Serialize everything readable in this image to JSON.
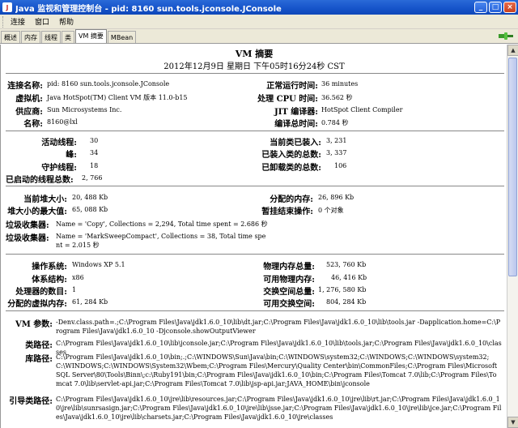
{
  "window": {
    "title": "Java 监视和管理控制台 - pid: 8160 sun.tools.jconsole.JConsole",
    "java_icon": "java-icon",
    "minimize": "_",
    "maximize": "□",
    "close": "×"
  },
  "menu": [
    "连接",
    "窗口",
    "帮助"
  ],
  "tabs": [
    "概述",
    "内存",
    "线程",
    "类",
    "VM 摘要",
    "MBean"
  ],
  "active_tab": "VM 摘要",
  "summary": {
    "title": "VM 摘要",
    "datetime": "2012年12月9日 星期日 下午05时16分24秒 CST"
  },
  "sec1": {
    "connection_name": {
      "label": "连接名称:",
      "value": "pid: 8160 sun.tools.jconsole.JConsole"
    },
    "vm": {
      "label": "虚拟机:",
      "value": "Java HotSpot(TM) Client VM 版本 11.0-b15"
    },
    "vendor": {
      "label": "供应商:",
      "value": "Sun Microsystems Inc."
    },
    "name": {
      "label": "名称:",
      "value": "8160@lxl"
    },
    "uptime": {
      "label": "正常运行时间:",
      "value": "36 minutes"
    },
    "cpu_time": {
      "label": "处理 CPU 时间:",
      "value": "36.562 秒"
    },
    "jit": {
      "label": "JIT 编译器:",
      "value": "HotSpot Client Compiler"
    },
    "compile_time": {
      "label": "编译总时间:",
      "value": "0.784 秒"
    }
  },
  "sec2": {
    "live_threads": {
      "label": "活动线程:",
      "value": "30"
    },
    "peak": {
      "label": "峰:",
      "value": "34"
    },
    "daemon": {
      "label": "守护线程:",
      "value": "18"
    },
    "started": {
      "label": "已启动的线程总数:",
      "value": "2, 766"
    },
    "loaded_classes": {
      "label": "当前类已装入:",
      "value": "3, 231"
    },
    "total_loaded": {
      "label": "已装入类的总数:",
      "value": "3, 337"
    },
    "unloaded": {
      "label": "已卸载类的总数:",
      "value": "106"
    }
  },
  "sec3": {
    "heap_size": {
      "label": "当前堆大小:",
      "value": "20, 488 Kb"
    },
    "heap_max": {
      "label": "堆大小的最大值:",
      "value": "65, 088 Kb"
    },
    "committed": {
      "label": "分配的内存:",
      "value": "26, 896 Kb"
    },
    "pending": {
      "label": "暂挂结束操作:",
      "value": "0 个对象"
    },
    "gc1": {
      "label": "垃圾收集器:",
      "value": "Name = 'Copy', Collections = 2,294, Total time spent = 2.686 秒"
    },
    "gc2": {
      "label": "垃圾收集器:",
      "value": "Name = 'MarkSweepCompact', Collections = 38, Total time spent = 2.015 秒"
    }
  },
  "sec4": {
    "os": {
      "label": "操作系统:",
      "value": "Windows XP 5.1"
    },
    "arch": {
      "label": "体系结构:",
      "value": "x86"
    },
    "cpus": {
      "label": "处理器的数目:",
      "value": "1"
    },
    "vmem": {
      "label": "分配的虚拟内存:",
      "value": "61, 284 Kb"
    },
    "phys_total": {
      "label": "物理内存总量:",
      "value": "523, 760 Kb"
    },
    "phys_free": {
      "label": "可用物理内存:",
      "value": "46, 416 Kb"
    },
    "swap_total": {
      "label": "交换空间总量:",
      "value": "1, 276, 580 Kb"
    },
    "swap_free": {
      "label": "可用交换空间:",
      "value": "804, 284 Kb"
    }
  },
  "sec5": {
    "vm_args": {
      "label": "VM 参数:",
      "value": "-Denv.class.path=.;C:\\Program Files\\Java\\jdk1.6.0_10\\lib\\dt.jar;C:\\Program Files\\Java\\jdk1.6.0_10\\lib\\tools.jar -Dapplication.home=C:\\Program Files\\Java\\jdk1.6.0_10 -Djconsole.showOutputViewer"
    },
    "classpath": {
      "label": "类路径:",
      "value": "C:\\Program Files\\Java\\jdk1.6.0_10\\lib\\jconsole.jar;C:\\Program Files\\Java\\jdk1.6.0_10\\lib\\tools.jar;C:\\Program Files\\Java\\jdk1.6.0_10\\classes"
    },
    "libpath": {
      "label": "库路径:",
      "value": "C:\\Program Files\\Java\\jdk1.6.0_10\\bin;.;C:\\WINDOWS\\Sun\\Java\\bin;C:\\WINDOWS\\system32;C:\\WINDOWS;C:\\WINDOWS\\system32;C:\\WINDOWS;C:\\WINDOWS\\System32\\Wbem;C:\\Program Files\\Mercury\\Quality Center\\bin\\CommonFiles;C:\\Program Files\\Microsoft SQL Server\\80\\Tools\\Binn\\;c:\\Ruby191\\bin;C:\\Program Files\\Java\\jdk1.6.0_10\\bin;C:\\Program Files\\Tomcat 7.0\\lib;C:\\Program Files\\Tomcat 7.0\\lib\\servlet-api.jar;C:\\Program Files\\Tomcat 7.0\\lib\\jsp-api.jar;JAVA_HOME\\bin\\jconsole"
    },
    "bootpath": {
      "label": "引导类路径:",
      "value": "C:\\Program Files\\Java\\jdk1.6.0_10\\jre\\lib\\resources.jar;C:\\Program Files\\Java\\jdk1.6.0_10\\jre\\lib\\rt.jar;C:\\Program Files\\Java\\jdk1.6.0_10\\jre\\lib\\sunrsasign.jar;C:\\Program Files\\Java\\jdk1.6.0_10\\jre\\lib\\jsse.jar;C:\\Program Files\\Java\\jdk1.6.0_10\\jre\\lib\\jce.jar;C:\\Program Files\\Java\\jdk1.6.0_10\\jre\\lib\\charsets.jar;C:\\Program Files\\Java\\jdk1.6.0_10\\jre\\classes"
    }
  }
}
